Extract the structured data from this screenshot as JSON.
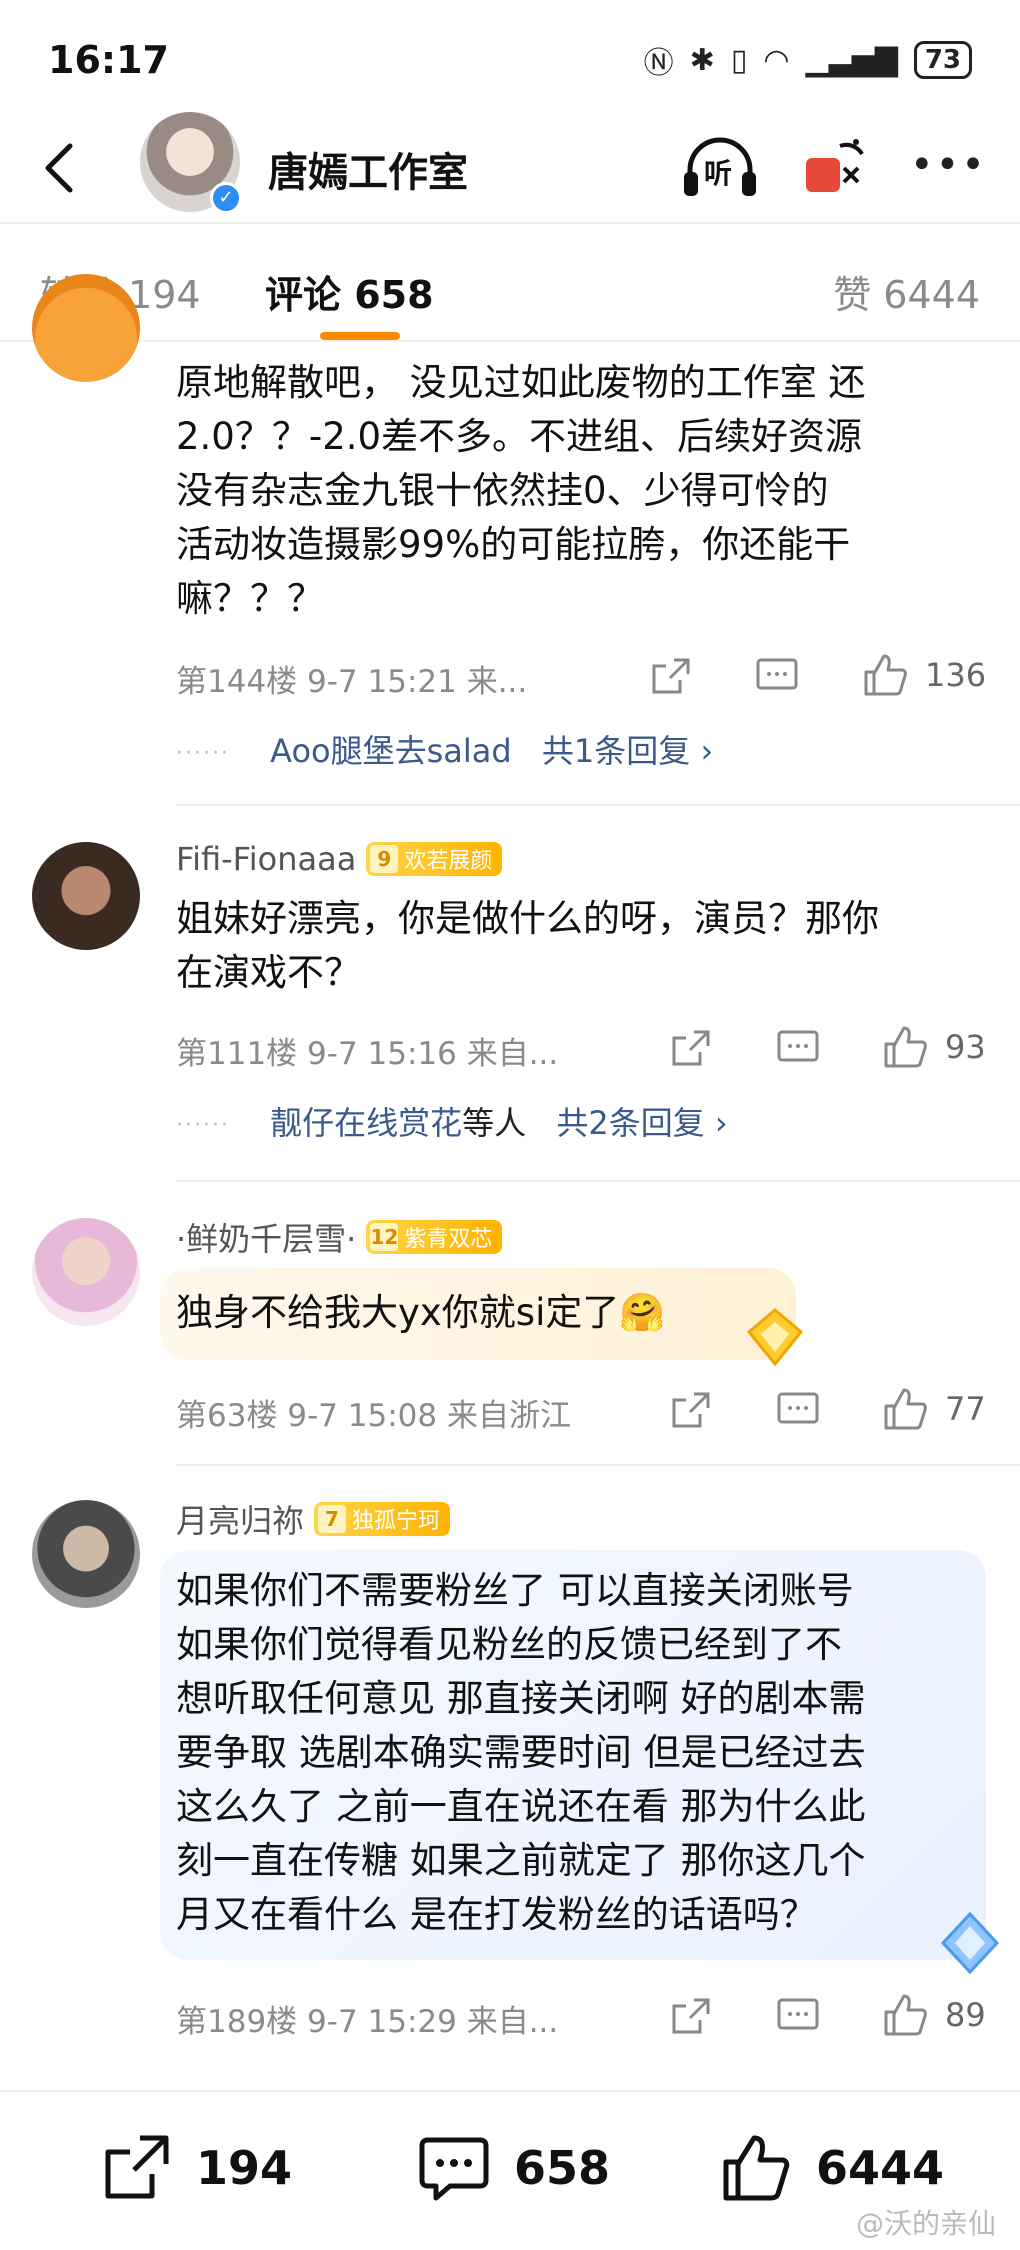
{
  "status": {
    "time": "16:17",
    "battery": "73"
  },
  "header": {
    "account_name": "唐嫣工作室",
    "listen_label": "听"
  },
  "tabs": {
    "repost": "转发 194",
    "comments": "评论 658",
    "likes": "赞 6444"
  },
  "comments": [
    {
      "text_lines": [
        "原地解散吧， 没见过如此废物的工作室 还",
        "2.0？？-2.0差不多。不进组、后续好资源",
        "没有杂志金九银十依然挂0、少得可怜的",
        "活动妆造摄影99%的可能拉胯，你还能干",
        "嘛？？？"
      ],
      "meta": "第144楼  9-7 15:21  来...",
      "likes": "136",
      "reply_user": "Aoo腿堡去salad",
      "reply_count": "共1条回复 ›"
    },
    {
      "username": "Fifi-Fionaaa",
      "badge_level": "9",
      "badge_text": "欢若展颜",
      "text_lines": [
        "姐妹好漂亮，你是做什么的呀，演员？那你",
        "在演戏不？"
      ],
      "meta": "第111楼  9-7 15:16  来自...",
      "likes": "93",
      "reply_user": "靓仔在线赏花",
      "reply_suffix": "等人",
      "reply_count": "共2条回复 ›"
    },
    {
      "username": "·鲜奶千层雪·",
      "badge_level": "12",
      "badge_text": "紫青双芯",
      "text_lines": [
        "独身不给我大yx你就si定了🤗"
      ],
      "meta": "第63楼  9-7 15:08  来自浙江",
      "likes": "77"
    },
    {
      "username": "月亮归祢",
      "badge_level": "7",
      "badge_text": "独孤宁珂",
      "text_lines": [
        "如果你们不需要粉丝了 可以直接关闭账号",
        "如果你们觉得看见粉丝的反馈已经到了不",
        "想听取任何意见 那直接关闭啊 好的剧本需",
        "要争取 选剧本确实需要时间 但是已经过去",
        "这么久了 之前一直在说还在看 那为什么此",
        "刻一直在传糖 如果之前就定了 那你这几个",
        "月又在看什么 是在打发粉丝的话语吗？"
      ],
      "meta": "第189楼  9-7 15:29  来自...",
      "likes": "89"
    }
  ],
  "bottom_bar": {
    "reposts": "194",
    "comments": "658",
    "likes": "6444"
  },
  "watermark": "@沃的亲仙",
  "icons": [
    "back-icon",
    "verified-icon",
    "headphones-icon",
    "gift-icon",
    "more-icon",
    "share-icon",
    "comment-icon",
    "like-icon"
  ],
  "colors": {
    "accent": "#ff8a00",
    "reply_link": "#3a5a8c",
    "badge": "#ffb300"
  }
}
